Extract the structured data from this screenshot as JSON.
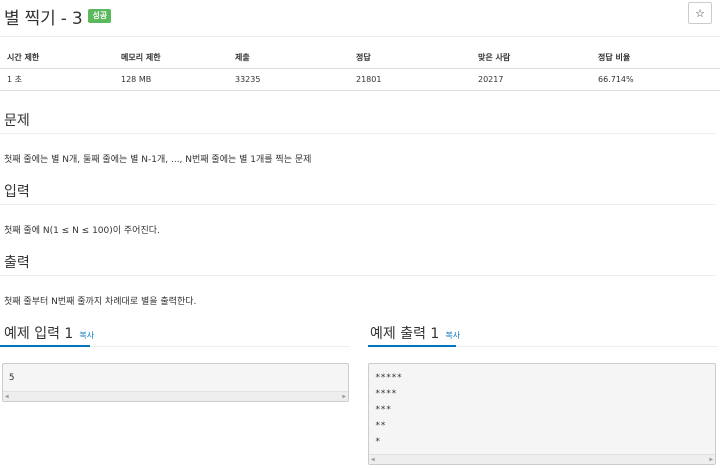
{
  "header": {
    "title": "별 찍기 - 3",
    "badge": "성공",
    "star_icon": "☆"
  },
  "stats": {
    "headers": [
      "시간 제한",
      "메모리 제한",
      "제출",
      "정답",
      "맞은 사람",
      "정답 비율"
    ],
    "values": [
      "1 초",
      "128 MB",
      "33235",
      "21801",
      "20217",
      "66.714%"
    ]
  },
  "problem": {
    "title": "문제",
    "body": "첫째 줄에는 별 N개, 둘째 줄에는 별 N-1개, ..., N번째 줄에는 별 1개를 찍는 문제"
  },
  "input": {
    "title": "입력",
    "body": "첫째 줄에 N(1 ≤ N ≤ 100)이 주어진다."
  },
  "output": {
    "title": "출력",
    "body": "첫째 줄부터 N번째 줄까지 차례대로 별을 출력한다."
  },
  "sample_input": {
    "title": "예제 입력 1",
    "copy": "복사",
    "content": "5"
  },
  "sample_output": {
    "title": "예제 출력 1",
    "copy": "복사",
    "content": "*****\n****\n***\n**\n*"
  },
  "scrollbar": {
    "left_arrow": "◀",
    "right_arrow": "▶"
  }
}
